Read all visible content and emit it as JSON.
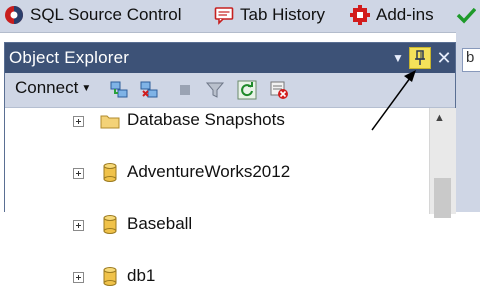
{
  "toolbar": {
    "items": [
      {
        "label": "SQL Source Control",
        "icon": "sql-source-control-icon"
      },
      {
        "label": "Tab History",
        "icon": "tab-history-icon"
      },
      {
        "label": "Add-ins",
        "icon": "add-ins-icon"
      }
    ]
  },
  "panel": {
    "title": "Object Explorer",
    "connect_label": "Connect",
    "tree": [
      {
        "label": "Database Snapshots",
        "icon": "folder-icon"
      },
      {
        "label": "AdventureWorks2012",
        "icon": "database-icon"
      },
      {
        "label": "Baseball",
        "icon": "database-icon"
      },
      {
        "label": "db1",
        "icon": "database-icon"
      }
    ]
  },
  "right_tab_text": "b",
  "colors": {
    "titlebar": "#3d5277",
    "toolbar": "#cfd6e5",
    "pin_highlight": "#f4e15a"
  }
}
